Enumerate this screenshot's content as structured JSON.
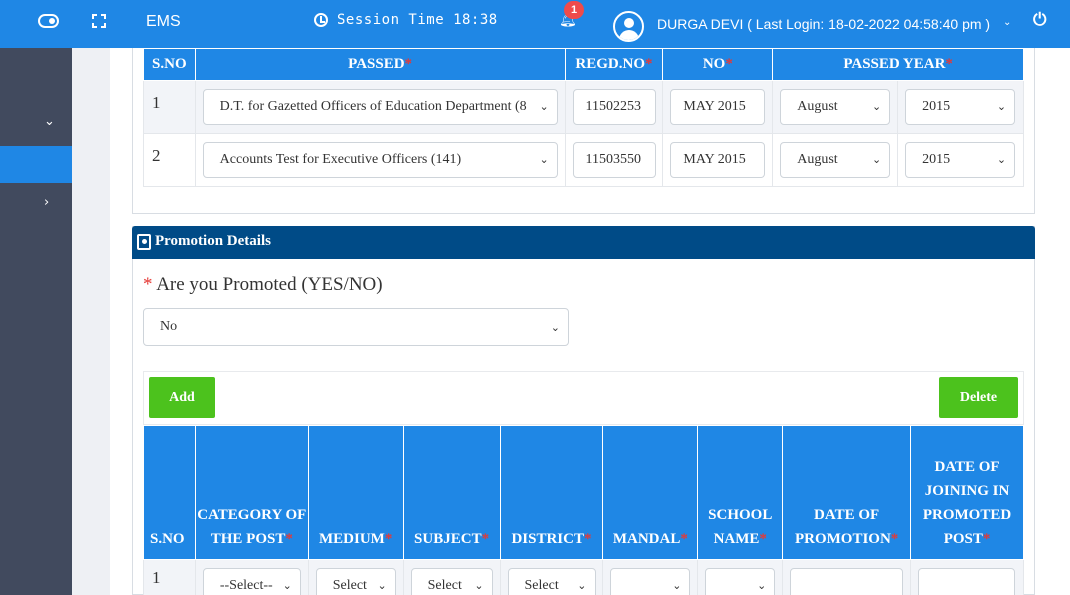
{
  "topbar": {
    "brand": "EMS",
    "session": "Session Time 18:38",
    "notifications": "1",
    "user": "DURGA DEVI ( Last Login: 18-02-2022 04:58:40 pm )",
    "accent": "#1f87e5"
  },
  "exam_table": {
    "headers": [
      "S.NO",
      "PASSED",
      "REGD.NO",
      "NO",
      "PASSED YEAR"
    ],
    "required_mark": "*",
    "rows": [
      {
        "sno": "1",
        "passed": "D.T. for Gazetted Officers of Education Department (8",
        "regd": "11502253",
        "no": "MAY 2015",
        "month": "August",
        "year": "2015"
      },
      {
        "sno": "2",
        "passed": "Accounts Test for Executive Officers (141)",
        "regd": "11503550",
        "no": "MAY 2015",
        "month": "August",
        "year": "2015"
      }
    ]
  },
  "promotion": {
    "title": "Promotion Details",
    "question_mark": "*",
    "question": "Are you Promoted (YES/NO)",
    "answer": "No",
    "add_label": "Add",
    "delete_label": "Delete",
    "button_color": "#4cc21d",
    "header_color": "#004b87",
    "columns": [
      {
        "label": "S.NO",
        "required": ""
      },
      {
        "label": "CATEGORY OF THE POST",
        "required": "*"
      },
      {
        "label": "MEDIUM",
        "required": "*"
      },
      {
        "label": "SUBJECT",
        "required": "*"
      },
      {
        "label": "DISTRICT",
        "required": "*"
      },
      {
        "label": "MANDAL",
        "required": "*"
      },
      {
        "label": "SCHOOL NAME",
        "required": "*"
      },
      {
        "label": "DATE OF PROMOTION",
        "required": "*"
      },
      {
        "label": "DATE OF JOINING IN PROMOTED POST",
        "required": "*"
      }
    ],
    "row": {
      "sno": "1",
      "category": "--Select--",
      "medium": "Select",
      "subject": "Select",
      "district": "Select",
      "mandal": "",
      "school": "",
      "date_promotion": "",
      "date_joining": ""
    }
  }
}
